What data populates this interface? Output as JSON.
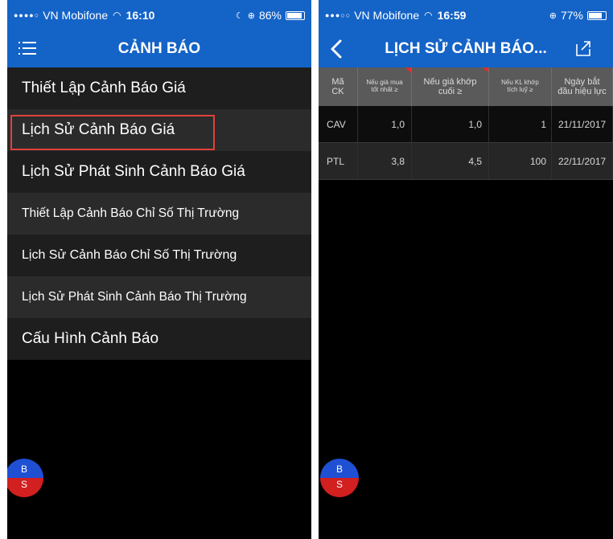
{
  "left": {
    "status": {
      "carrier": "VN Mobifone",
      "time": "16:10",
      "battery": "86%",
      "battery_level": 0.86
    },
    "header": {
      "title": "CẢNH BÁO"
    },
    "menu": [
      {
        "label": "Thiết Lập Cảnh Báo Giá"
      },
      {
        "label": "Lịch Sử Cảnh Báo Giá"
      },
      {
        "label": "Lịch Sử Phát Sinh Cảnh Báo Giá"
      },
      {
        "label": "Thiết Lập Cảnh Báo Chỉ Số Thị Trường"
      },
      {
        "label": "Lịch Sử Cảnh Báo Chỉ Số  Thị Trường"
      },
      {
        "label": "Lịch Sử Phát Sinh Cảnh Báo Thị Trường"
      },
      {
        "label": "Cấu Hình Cảnh Báo"
      }
    ],
    "bs_button": {
      "buy": "B",
      "sell": "S"
    }
  },
  "right": {
    "status": {
      "carrier": "VN Mobifone",
      "time": "16:59",
      "battery": "77%",
      "battery_level": 0.77
    },
    "header": {
      "title": "LỊCH SỬ CẢNH BÁO..."
    },
    "table": {
      "columns": [
        {
          "line1": "Mã",
          "line2": "CK"
        },
        {
          "line1": "Nếu giá mua",
          "line2": "tốt nhất ≥"
        },
        {
          "line1": "Nếu giá khớp",
          "line2": "cuối ≥"
        },
        {
          "line1": "Nếu KL khớp",
          "line2": "tích luỹ ≥"
        },
        {
          "line1": "Ngày bắt",
          "line2": "đầu hiệu lực"
        }
      ],
      "rows": [
        {
          "code": "CAV",
          "best_buy": "1,0",
          "last_match": "1,0",
          "volume": "1",
          "start_date": "21/11/2017"
        },
        {
          "code": "PTL",
          "best_buy": "3,8",
          "last_match": "4,5",
          "volume": "100",
          "start_date": "22/11/2017"
        }
      ]
    },
    "bs_button": {
      "buy": "B",
      "sell": "S"
    }
  },
  "colors": {
    "header_blue": "#1463c7",
    "highlight_red": "#e2403a",
    "buy_blue": "#1f4fd3",
    "sell_red": "#d21f1f"
  }
}
